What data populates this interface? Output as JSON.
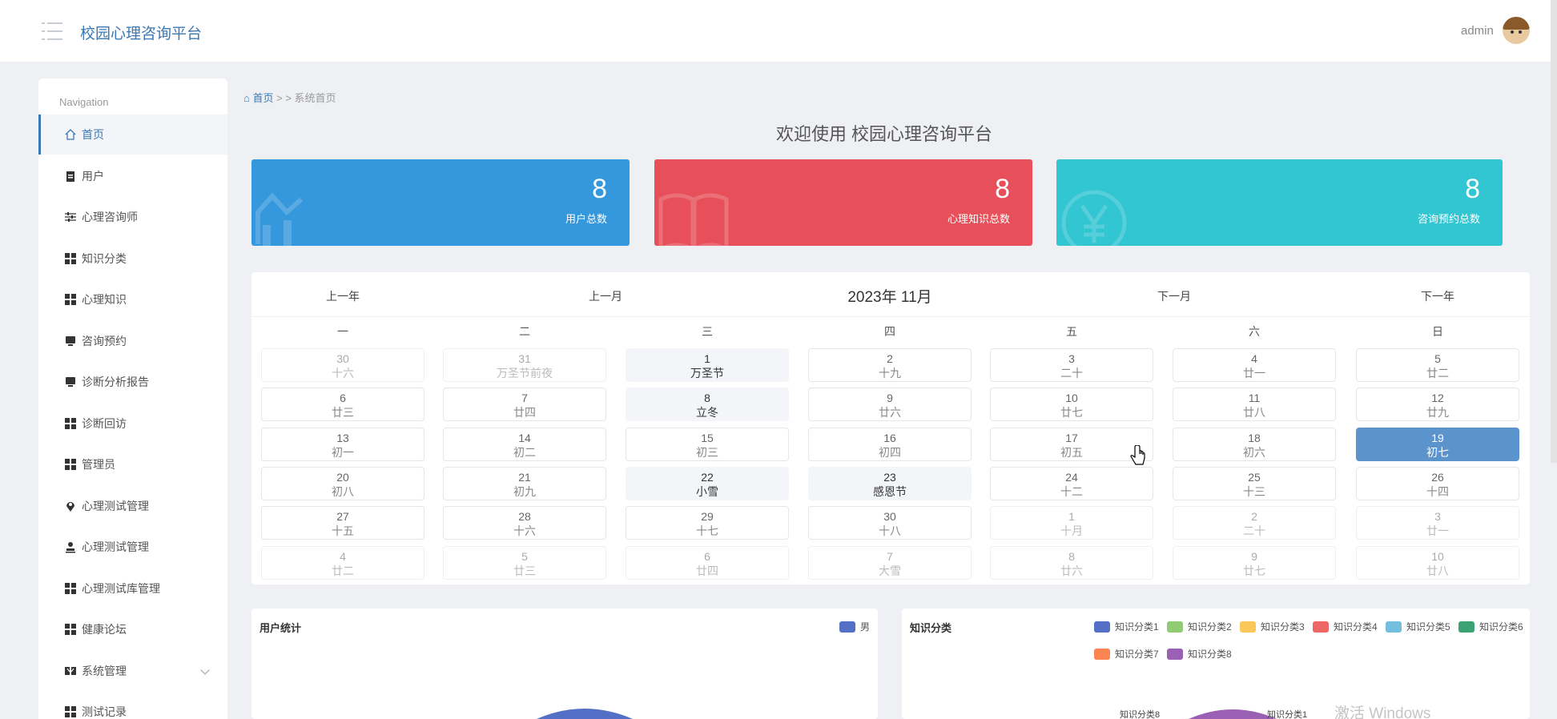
{
  "header": {
    "app_title": "校园心理咨询平台",
    "user_name": "admin"
  },
  "sidebar": {
    "heading": "Navigation",
    "items": [
      {
        "label": "首页",
        "icon": "home-icon"
      },
      {
        "label": "用户",
        "icon": "clipboard-icon"
      },
      {
        "label": "心理咨询师",
        "icon": "sliders-icon"
      },
      {
        "label": "知识分类",
        "icon": "grid-icon"
      },
      {
        "label": "心理知识",
        "icon": "grid-icon"
      },
      {
        "label": "咨询预约",
        "icon": "monitor-icon"
      },
      {
        "label": "诊断分析报告",
        "icon": "monitor-icon"
      },
      {
        "label": "诊断回访",
        "icon": "grid-icon"
      },
      {
        "label": "管理员",
        "icon": "grid-icon"
      },
      {
        "label": "心理测试管理",
        "icon": "map-pin-icon"
      },
      {
        "label": "心理测试管理",
        "icon": "user-icon"
      },
      {
        "label": "心理测试库管理",
        "icon": "grid-icon"
      },
      {
        "label": "健康论坛",
        "icon": "grid-icon"
      },
      {
        "label": "系统管理",
        "icon": "bookmark-icon"
      },
      {
        "label": "测试记录",
        "icon": "grid-icon"
      }
    ]
  },
  "breadcrumb": {
    "home": "首页",
    "separator": "> >",
    "current": "系统首页"
  },
  "welcome": "欢迎使用 校园心理咨询平台",
  "stats": [
    {
      "value": "8",
      "label": "用户总数",
      "color": "#3598dc",
      "icon": "chart-icon"
    },
    {
      "value": "8",
      "label": "心理知识总数",
      "color": "#e7505a",
      "icon": "book-icon"
    },
    {
      "value": "8",
      "label": "咨询预约总数",
      "color": "#32c5d2",
      "icon": "yen-icon"
    }
  ],
  "calendar": {
    "prev_year": "上一年",
    "prev_month": "上一月",
    "title": "2023年 11月",
    "next_month": "下一月",
    "next_year": "下一年",
    "weekdays": [
      "一",
      "二",
      "三",
      "四",
      "五",
      "六",
      "日"
    ],
    "days": [
      {
        "d": "30",
        "l": "十六",
        "s": "other"
      },
      {
        "d": "31",
        "l": "万圣节前夜",
        "s": "other"
      },
      {
        "d": "1",
        "l": "万圣节",
        "s": "fest"
      },
      {
        "d": "2",
        "l": "十九",
        "s": ""
      },
      {
        "d": "3",
        "l": "二十",
        "s": ""
      },
      {
        "d": "4",
        "l": "廿一",
        "s": ""
      },
      {
        "d": "5",
        "l": "廿二",
        "s": ""
      },
      {
        "d": "6",
        "l": "廿三",
        "s": ""
      },
      {
        "d": "7",
        "l": "廿四",
        "s": ""
      },
      {
        "d": "8",
        "l": "立冬",
        "s": "fest"
      },
      {
        "d": "9",
        "l": "廿六",
        "s": ""
      },
      {
        "d": "10",
        "l": "廿七",
        "s": ""
      },
      {
        "d": "11",
        "l": "廿八",
        "s": ""
      },
      {
        "d": "12",
        "l": "廿九",
        "s": ""
      },
      {
        "d": "13",
        "l": "初一",
        "s": ""
      },
      {
        "d": "14",
        "l": "初二",
        "s": ""
      },
      {
        "d": "15",
        "l": "初三",
        "s": ""
      },
      {
        "d": "16",
        "l": "初四",
        "s": ""
      },
      {
        "d": "17",
        "l": "初五",
        "s": ""
      },
      {
        "d": "18",
        "l": "初六",
        "s": ""
      },
      {
        "d": "19",
        "l": "初七",
        "s": "today"
      },
      {
        "d": "20",
        "l": "初八",
        "s": ""
      },
      {
        "d": "21",
        "l": "初九",
        "s": ""
      },
      {
        "d": "22",
        "l": "小雪",
        "s": "fest"
      },
      {
        "d": "23",
        "l": "感恩节",
        "s": "fest"
      },
      {
        "d": "24",
        "l": "十二",
        "s": ""
      },
      {
        "d": "25",
        "l": "十三",
        "s": ""
      },
      {
        "d": "26",
        "l": "十四",
        "s": ""
      },
      {
        "d": "27",
        "l": "十五",
        "s": ""
      },
      {
        "d": "28",
        "l": "十六",
        "s": ""
      },
      {
        "d": "29",
        "l": "十七",
        "s": ""
      },
      {
        "d": "30",
        "l": "十八",
        "s": ""
      },
      {
        "d": "1",
        "l": "十月",
        "s": "other"
      },
      {
        "d": "2",
        "l": "二十",
        "s": "other"
      },
      {
        "d": "3",
        "l": "廿一",
        "s": "other"
      },
      {
        "d": "4",
        "l": "廿二",
        "s": "other"
      },
      {
        "d": "5",
        "l": "廿三",
        "s": "other"
      },
      {
        "d": "6",
        "l": "廿四",
        "s": "other"
      },
      {
        "d": "7",
        "l": "大雪",
        "s": "other"
      },
      {
        "d": "8",
        "l": "廿六",
        "s": "other"
      },
      {
        "d": "9",
        "l": "廿七",
        "s": "other"
      },
      {
        "d": "10",
        "l": "廿八",
        "s": "other"
      }
    ]
  },
  "user_chart": {
    "title": "用户统计",
    "legend": [
      {
        "name": "男",
        "color": "#5470c6"
      }
    ]
  },
  "knowledge_chart": {
    "title": "知识分类",
    "legend": [
      {
        "name": "知识分类1",
        "color": "#5470c6"
      },
      {
        "name": "知识分类2",
        "color": "#91cc75"
      },
      {
        "name": "知识分类3",
        "color": "#fac858"
      },
      {
        "name": "知识分类4",
        "color": "#ee6666"
      },
      {
        "name": "知识分类5",
        "color": "#73c0de"
      },
      {
        "name": "知识分类6",
        "color": "#3ba272"
      },
      {
        "name": "知识分类7",
        "color": "#fc8452"
      },
      {
        "name": "知识分类8",
        "color": "#9a60b4"
      }
    ],
    "slice_labels": [
      "知识分类8",
      "知识分类1"
    ]
  },
  "watermark": "激活 Windows"
}
